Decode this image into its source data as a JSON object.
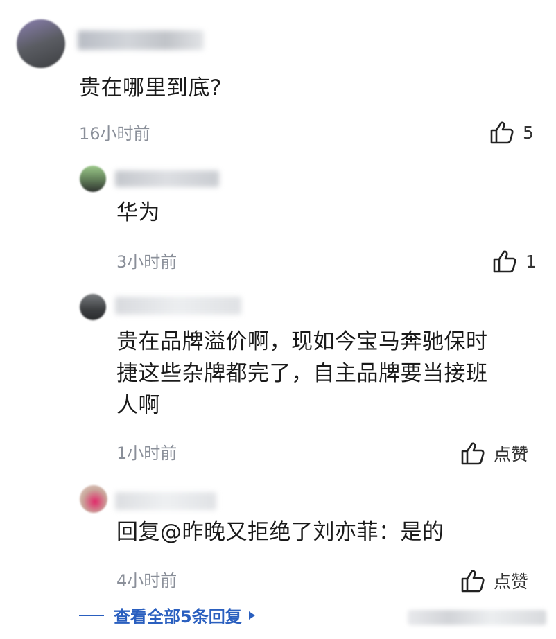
{
  "top_comment": {
    "text": "贵在哪里到底?",
    "time": "16小时前",
    "likes": "5"
  },
  "replies": [
    {
      "text": "华为",
      "time": "3小时前",
      "likes": "1"
    },
    {
      "text_lines": [
        "贵在品牌溢价啊，现如今宝马奔驰保时",
        "捷这些杂牌都完了，自主品牌要当接班",
        "人啊"
      ],
      "time": "1小时前",
      "likes": "点赞"
    },
    {
      "text": "回复@昨晚又拒绝了刘亦菲：是的",
      "time": "4小时前",
      "likes": "点赞"
    }
  ],
  "view_all_label": "查看全部5条回复",
  "colors": {
    "link": "#2a5fbf",
    "time": "#8a8f99"
  },
  "icons": {
    "like": "thumbs-up-icon",
    "expand": "triangle-right-icon"
  }
}
